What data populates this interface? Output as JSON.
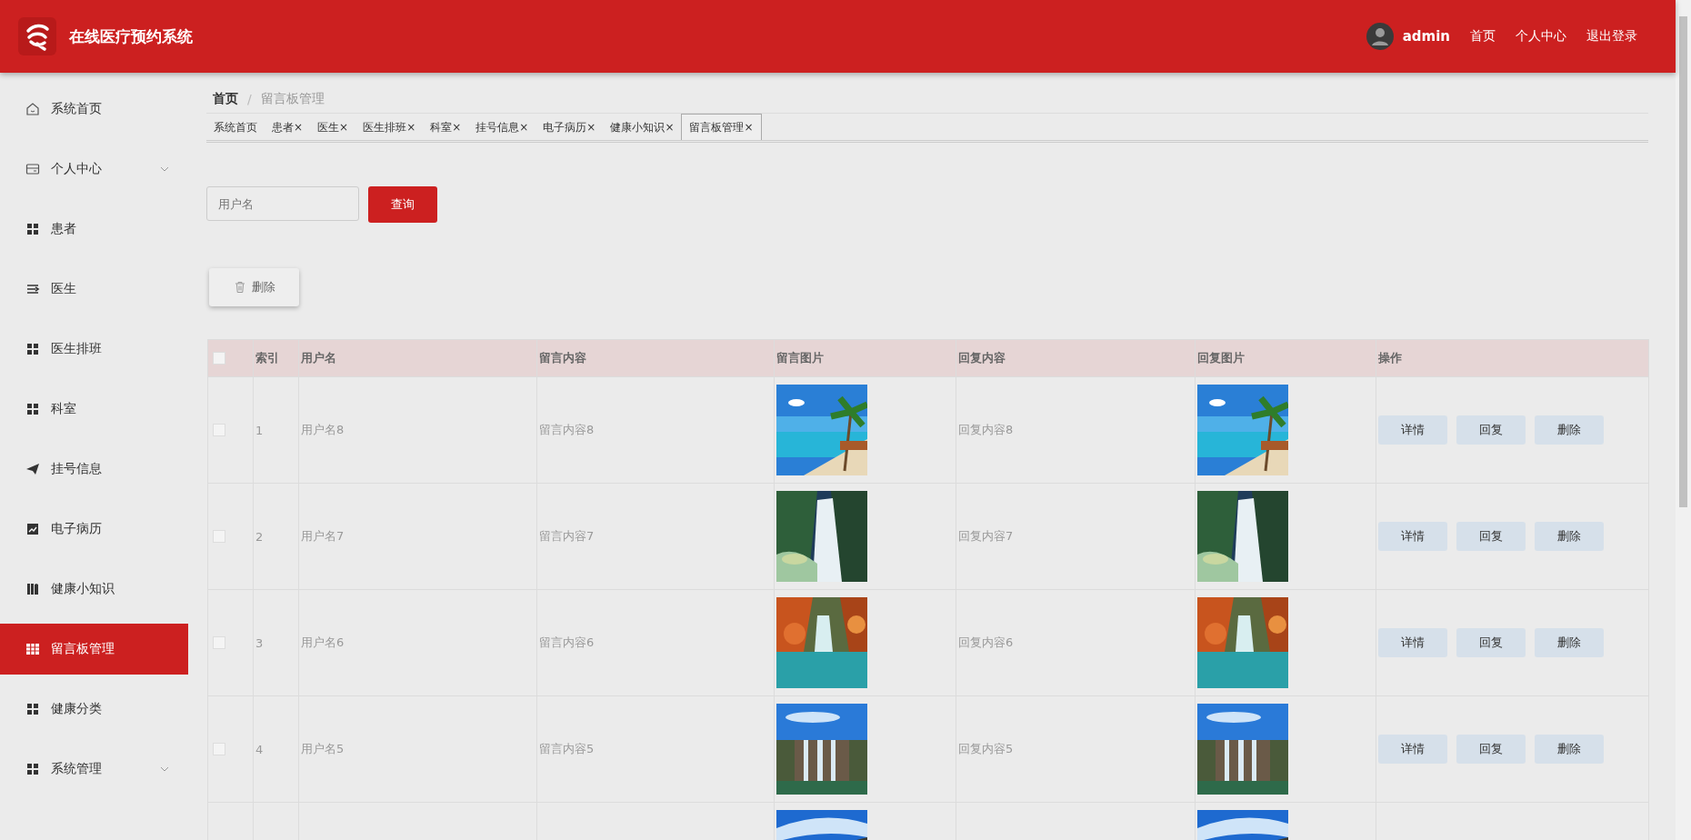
{
  "header": {
    "title": "在线医疗预约系统",
    "user": "admin",
    "links": [
      "首页",
      "个人中心",
      "退出登录"
    ]
  },
  "sidebar": {
    "items": [
      {
        "label": "系统首页",
        "selected": false
      },
      {
        "label": "个人中心",
        "selected": false,
        "expanded": false
      },
      {
        "label": "患者",
        "selected": false
      },
      {
        "label": "医生",
        "selected": false
      },
      {
        "label": "医生排班",
        "selected": false
      },
      {
        "label": "科室",
        "selected": false
      },
      {
        "label": "挂号信息",
        "selected": false
      },
      {
        "label": "电子病历",
        "selected": false
      },
      {
        "label": "健康小知识",
        "selected": false
      },
      {
        "label": "留言板管理",
        "selected": true
      },
      {
        "label": "健康分类",
        "selected": false
      },
      {
        "label": "系统管理",
        "selected": false,
        "expanded": false
      }
    ]
  },
  "breadcrumb": [
    "首页",
    "/",
    "留言板管理"
  ],
  "tabs": [
    {
      "label": "系统首页",
      "selected": false
    },
    {
      "label": "患者",
      "close": "×",
      "selected": false
    },
    {
      "label": "医生",
      "close": "×",
      "selected": false
    },
    {
      "label": "医生排班",
      "close": "×",
      "selected": false
    },
    {
      "label": "科室",
      "close": "×",
      "selected": false
    },
    {
      "label": "挂号信息",
      "close": "×",
      "selected": false
    },
    {
      "label": "电子病历",
      "close": "×",
      "selected": false
    },
    {
      "label": "健康小知识",
      "close": "×",
      "selected": false
    },
    {
      "label": "留言板管理",
      "close": "×",
      "selected": true
    }
  ],
  "search": {
    "placeholder": "用户名",
    "button": "查询"
  },
  "delete_button": "删除",
  "table": {
    "select_all_checked": false,
    "columns": [
      "索引",
      "用户名",
      "留言内容",
      "留言图片",
      "回复内容",
      "回复图片",
      "操作"
    ],
    "rows": [
      {
        "checked": false,
        "index": "1",
        "username": "用户名8",
        "message": "留言内容8",
        "message_image": {
          "kind": "picture"
        },
        "reply": "回复内容8",
        "reply_image": {
          "kind": "picture"
        },
        "actions": [
          "详情",
          "回复",
          "删除"
        ]
      },
      {
        "checked": false,
        "index": "2",
        "username": "用户名7",
        "message": "留言内容7",
        "message_image": {
          "kind": "picture"
        },
        "reply": "回复内容7",
        "reply_image": {
          "kind": "picture"
        },
        "actions": [
          "详情",
          "回复",
          "删除"
        ]
      },
      {
        "checked": false,
        "index": "3",
        "username": "用户名6",
        "message": "留言内容6",
        "message_image": {
          "kind": "picture"
        },
        "reply": "回复内容6",
        "reply_image": {
          "kind": "picture"
        },
        "actions": [
          "详情",
          "回复",
          "删除"
        ]
      },
      {
        "checked": false,
        "index": "4",
        "username": "用户名5",
        "message": "留言内容5",
        "message_image": {
          "kind": "picture"
        },
        "reply": "回复内容5",
        "reply_image": {
          "kind": "picture"
        },
        "actions": [
          "详情",
          "回复",
          "删除"
        ]
      },
      {
        "message_image": {
          "kind": "picture"
        },
        "reply_image": {
          "kind": "picture"
        }
      }
    ]
  }
}
